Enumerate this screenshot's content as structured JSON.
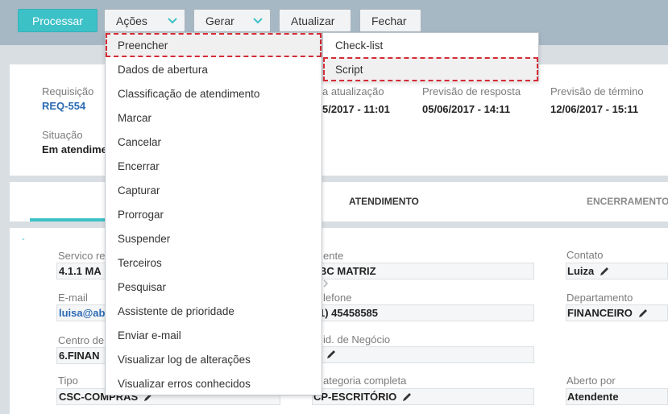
{
  "toolbar": {
    "processar": "Processar",
    "acoes": "Ações",
    "gerar": "Gerar",
    "atualizar": "Atualizar",
    "fechar": "Fechar"
  },
  "header": {
    "requisicao_label": "Requisição",
    "requisicao_value": "REQ-554",
    "situacao_label": "Situação",
    "situacao_value": "Em atendime",
    "atualizacao_label": "a atualização",
    "atualizacao_value": "5/2017 - 11:01",
    "prev_resposta_label": "Previsão de resposta",
    "prev_resposta_value": "05/06/2017 - 14:11",
    "prev_termino_label": "Previsão de término",
    "prev_termino_value": "12/06/2017 - 15:11"
  },
  "tabs": {
    "atendimento": "ATENDIMENTO",
    "encerramento": "ENCERRAMENTO"
  },
  "form": {
    "dash": "-",
    "servico_label": "Servico re",
    "servico_value": "4.1.1 MA",
    "email_label": "E-mail",
    "email_value": "luisa@ab",
    "centro_label": "Centro de",
    "centro_value": "6.FINAN",
    "tipo_label": "Tipo",
    "tipo_value": "CSC-COMPRAS",
    "cliente_label": "ente",
    "cliente_value": "BC MATRIZ",
    "telefone_label": "lefone",
    "telefone_value": "1) 45458585",
    "unid_label": "id. de Negócio",
    "categoria_label": "ategoria completa",
    "categoria_value": "CP-ESCRITÓRIO",
    "contato_label": "Contato",
    "contato_value": "Luiza",
    "departamento_label": "Departamento",
    "departamento_value": "FINANCEIRO",
    "aberto_label": "Aberto por",
    "aberto_value": "Atendente"
  },
  "menu": {
    "items": [
      "Preencher",
      "Dados de abertura",
      "Classificação de atendimento",
      "Marcar",
      "Cancelar",
      "Encerrar",
      "Capturar",
      "Prorrogar",
      "Suspender",
      "Terceiros",
      "Pesquisar",
      "Assistente de prioridade",
      "Enviar e-mail",
      "Visualizar log de alterações",
      "Visualizar erros conhecidos"
    ]
  },
  "submenu": {
    "items": [
      "Check-list",
      "Script"
    ]
  },
  "colors": {
    "accent": "#3cc1c7",
    "link": "#2a6ab3",
    "highlight_outline": "#d62b35",
    "toolbar_bg": "#a7b8c5"
  }
}
